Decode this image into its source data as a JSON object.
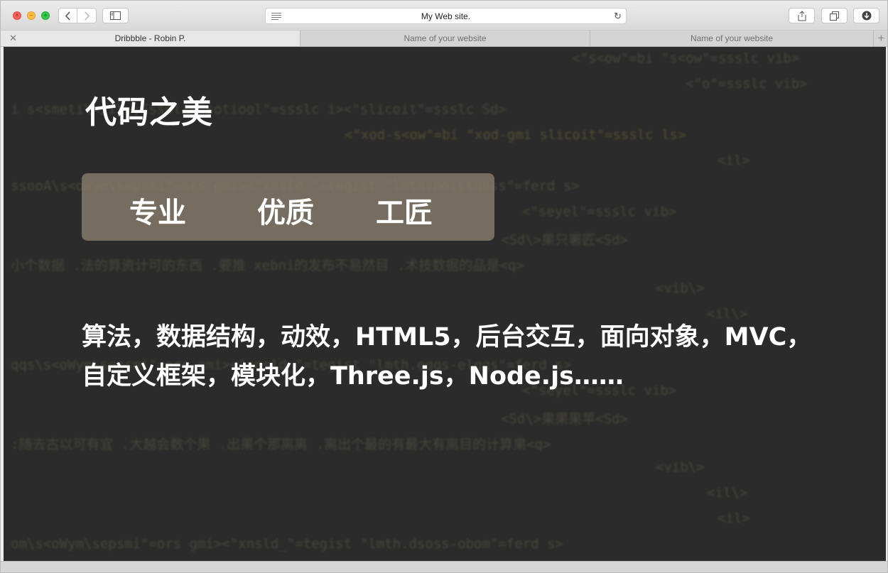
{
  "window": {
    "address_url": "My Web site."
  },
  "icons": {
    "back": "chevron-left-icon",
    "forward": "chevron-right-icon",
    "sidebar": "sidebar-icon",
    "reader": "reader-icon",
    "reload": "reload-icon",
    "share": "share-icon",
    "tabs": "tabs-icon",
    "downloads": "download-icon"
  },
  "tabs": [
    {
      "label": "Dribbble  -  Robin P.",
      "active": true
    },
    {
      "label": "Name of your website",
      "active": false
    },
    {
      "label": "Name of your website",
      "active": false
    }
  ],
  "hero": {
    "title": "代码之美",
    "pill_words": [
      "专业",
      "优质",
      "工匠"
    ],
    "desc_line1": "算法，数据结构，动效，HTML5，后台交互，面向对象，MVC，",
    "desc_line2": "自定义框架，模块化，Three.js，Node.js……"
  },
  "colors": {
    "content_bg": "#2b2b2b",
    "pill_bg": "#8a7e6e",
    "text": "#ffffff"
  }
}
